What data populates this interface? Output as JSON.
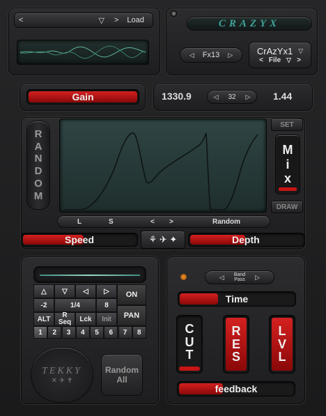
{
  "preset": {
    "prev": "<",
    "next": ">",
    "menu": "▽",
    "load": "Load"
  },
  "brand": {
    "logo": "CRAZYX"
  },
  "fx": {
    "prev": "◁",
    "value": "Fx13",
    "next": "▷"
  },
  "file": {
    "name": "CrAzYx1",
    "dropdown": "▽",
    "prev": "<",
    "label": "File",
    "dropdown2": "▽",
    "next": ">"
  },
  "gain": {
    "label": "Gain",
    "level": 1.0
  },
  "readouts": {
    "value1": "1330.9",
    "stepper_prev": "◁",
    "stepper_value": "32",
    "stepper_next": "▷",
    "value2": "1.44"
  },
  "random_side": {
    "letters": [
      "R",
      "A",
      "N",
      "D",
      "O",
      "M"
    ]
  },
  "mix": {
    "set": "SET",
    "letters": [
      "M",
      "i",
      "x"
    ],
    "draw": "DRAW"
  },
  "display_bar": {
    "l": "L",
    "s": "S",
    "prev": "<",
    "next": ">",
    "random": "Random"
  },
  "speed": {
    "label": "Speed",
    "level": 0.55
  },
  "depth": {
    "label": "Depth",
    "level": 0.5
  },
  "center_icons": {
    "figures": "⚘ ✈ ✦"
  },
  "seq": {
    "row1": [
      "△",
      "▽",
      "◁",
      "▷"
    ],
    "on": "ON",
    "row2": [
      "-2",
      "1/4",
      "8"
    ],
    "row3_alt": "ALT",
    "row3_rseq_top": "R",
    "row3_rseq_bot": "Seq",
    "row3_lck": "Lck",
    "row3_init": "Init",
    "pan": "PAN",
    "steps": [
      "1",
      "2",
      "3",
      "4",
      "5",
      "6",
      "7",
      "8"
    ]
  },
  "tekky": {
    "line1": "TEKKY",
    "line2": "✕ ✈ ✝"
  },
  "random_all": {
    "line1": "Random",
    "line2": "All"
  },
  "band": {
    "prev": "◁",
    "line1": "Band",
    "line2": "Pass",
    "next": "▷"
  },
  "time": {
    "label": "Time",
    "level": 0.35
  },
  "cut": {
    "letters": [
      "C",
      "U",
      "T"
    ],
    "level": 0.15
  },
  "res": {
    "letters": [
      "R",
      "E",
      "S"
    ],
    "level": 1.0
  },
  "lvl": {
    "letters": [
      "L",
      "V",
      "L"
    ],
    "level": 1.0
  },
  "feedback": {
    "label": "feedback",
    "level": 0.4
  },
  "colors": {
    "accent_red": "#c81414",
    "lcd": "#223433",
    "logo": "#3fa39a"
  }
}
